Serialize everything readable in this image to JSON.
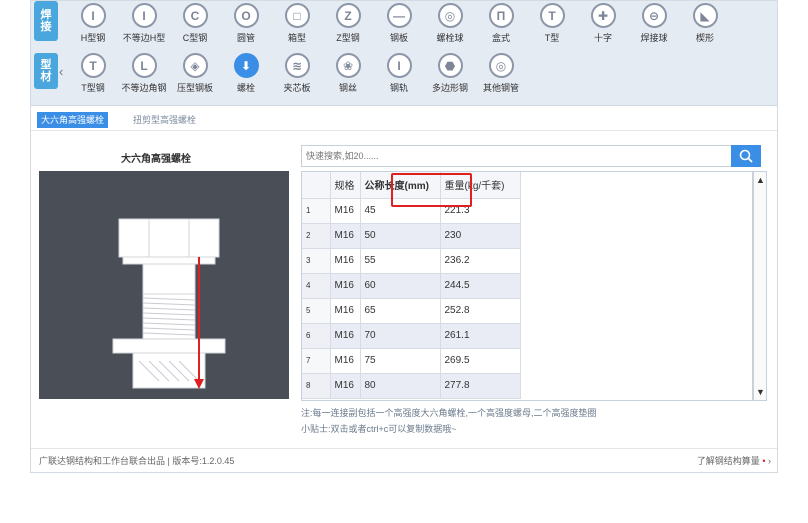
{
  "side_tabs": {
    "weld": [
      "焊",
      "接"
    ],
    "section": [
      "型",
      "材"
    ]
  },
  "tools_row1": [
    {
      "label": "H型钢",
      "glyph": "I",
      "icon": "h-beam-icon"
    },
    {
      "label": "不等边H型",
      "glyph": "I",
      "icon": "unequal-h-icon"
    },
    {
      "label": "C型钢",
      "glyph": "C",
      "icon": "c-channel-icon"
    },
    {
      "label": "圆管",
      "glyph": "O",
      "icon": "round-pipe-icon"
    },
    {
      "label": "箱型",
      "glyph": "□",
      "icon": "box-section-icon"
    },
    {
      "label": "Z型钢",
      "glyph": "Z",
      "icon": "z-section-icon"
    },
    {
      "label": "钢板",
      "glyph": "—",
      "icon": "steel-plate-icon"
    },
    {
      "label": "螺栓球",
      "glyph": "◎",
      "icon": "bolt-ball-icon"
    },
    {
      "label": "盒式",
      "glyph": "Π",
      "icon": "box-type-icon"
    },
    {
      "label": "T型",
      "glyph": "T",
      "icon": "t-type-icon"
    },
    {
      "label": "十字",
      "glyph": "✚",
      "icon": "cross-icon"
    },
    {
      "label": "焊接球",
      "glyph": "⊖",
      "icon": "welded-ball-icon"
    },
    {
      "label": "楔形",
      "glyph": "◣",
      "icon": "wedge-icon"
    }
  ],
  "tools_row2": [
    {
      "label": "T型钢",
      "glyph": "T",
      "icon": "t-steel-icon"
    },
    {
      "label": "不等边角钢",
      "glyph": "L",
      "icon": "unequal-angle-icon"
    },
    {
      "label": "压型钢板",
      "glyph": "◈",
      "icon": "profiled-sheet-icon"
    },
    {
      "label": "螺栓",
      "glyph": "⬇",
      "icon": "bolt-icon",
      "active": true
    },
    {
      "label": "夹芯板",
      "glyph": "≋",
      "icon": "sandwich-panel-icon"
    },
    {
      "label": "钢丝",
      "glyph": "❀",
      "icon": "steel-wire-icon"
    },
    {
      "label": "钢轨",
      "glyph": "I",
      "icon": "rail-icon"
    },
    {
      "label": "多边形钢",
      "glyph": "⬣",
      "icon": "polygon-steel-icon"
    },
    {
      "label": "其他钢管",
      "glyph": "◎",
      "icon": "other-pipe-icon"
    }
  ],
  "subtabs": [
    "大六角高强螺栓",
    "扭剪型高强螺栓"
  ],
  "left_title": "大六角高强螺栓",
  "search": {
    "placeholder": "快速搜索,如20......"
  },
  "table": {
    "headers": [
      "规格",
      "公称长度(mm)",
      "重量(kg/千套)"
    ],
    "rows": [
      [
        "1",
        "M16",
        "45",
        "221.3"
      ],
      [
        "2",
        "M16",
        "50",
        "230"
      ],
      [
        "3",
        "M16",
        "55",
        "236.2"
      ],
      [
        "4",
        "M16",
        "60",
        "244.5"
      ],
      [
        "5",
        "M16",
        "65",
        "252.8"
      ],
      [
        "6",
        "M16",
        "70",
        "261.1"
      ],
      [
        "7",
        "M16",
        "75",
        "269.5"
      ],
      [
        "8",
        "M16",
        "80",
        "277.8"
      ]
    ]
  },
  "notes": [
    "注:每一连接副包括一个高强度大六角螺栓,一个高强度螺母,二个高强度垫圈",
    "小贴士:双击或者ctrl+c可以复制数据哦~"
  ],
  "footer": {
    "left": "广联达钢结构和工作台联合出品 | 版本号:1.2.0.45",
    "right": "了解钢结构算量"
  },
  "colors": {
    "accent": "#3a8ee6",
    "highlight": "#e02020",
    "toolbar_bg": "#e5ebf3"
  }
}
